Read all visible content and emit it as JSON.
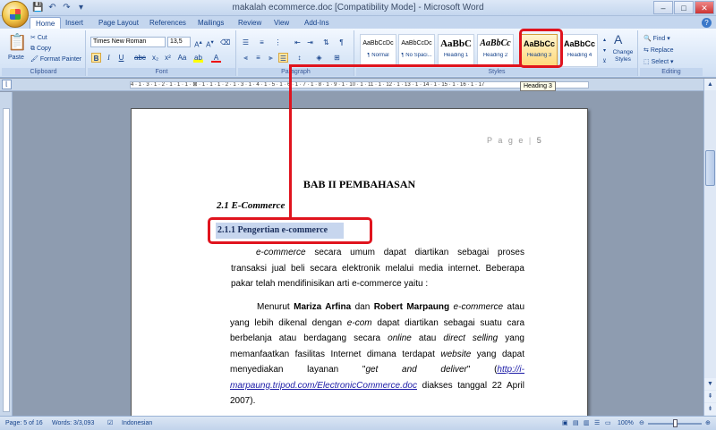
{
  "window": {
    "title": "makalah ecommerce.doc [Compatibility Mode] - Microsoft Word",
    "controls": [
      "–",
      "□",
      "✕"
    ]
  },
  "quick_access": [
    "💾",
    "↶",
    "↷",
    "▾"
  ],
  "tabs": [
    "Home",
    "Insert",
    "Page Layout",
    "References",
    "Mailings",
    "Review",
    "View",
    "Add-Ins"
  ],
  "ribbon": {
    "clipboard": {
      "paste_label": "Paste",
      "cut_label": "Cut",
      "copy_label": "Copy",
      "format_painter_label": "Format Painter",
      "group_label": "Clipboard"
    },
    "font": {
      "font_name": "Times New Roman",
      "font_size": "13,5",
      "group_label": "Font"
    },
    "paragraph": {
      "group_label": "Paragraph"
    },
    "styles": {
      "group_label": "Styles",
      "items": [
        {
          "sample": "AaBbCcDc",
          "name": "¶ Normal"
        },
        {
          "sample": "AaBbCcDc",
          "name": "¶ No Spaci..."
        },
        {
          "sample": "AaBbC",
          "name": "Heading 1"
        },
        {
          "sample": "AaBbCc",
          "name": "Heading 2"
        },
        {
          "sample": "AaBbCc",
          "name": "Heading 3"
        },
        {
          "sample": "AaBbCc",
          "name": "Heading 4"
        }
      ],
      "change_styles_label": "Change Styles"
    },
    "editing": {
      "group_label": "Editing",
      "find_label": "Find",
      "replace_label": "Replace",
      "select_label": "Select"
    }
  },
  "ruler": {
    "marks": "4 · 1 · 3 · 1 · 2 · 1 · 1 · 1 · ⊠ · 1 · 1 · 1 · 2 · 1 · 3 · 1 · 4 · 1 · 5 · 1 · 6 · 1 · 7 · 1 · 8 · 1 · 9 · 1 · 10 · 1 · 11 · 1 · 12 · 1 · 13 · 1 · 14 · 1 · 15 · 1 · 16 · 1 · 17"
  },
  "tooltip": "Heading 3",
  "document": {
    "header_text": "P a g e",
    "header_page": "5",
    "chapter_title": "BAB II PEMBAHASAN",
    "section_title": "2.1 E-Commerce",
    "subsection_title": "2.1.1 Pengertian e-commerce",
    "para1": {
      "term": "e-commerce",
      "text": " secara umum dapat diartikan sebagai proses transaksi jual beli secara elektronik melalui media internet. Beberapa pakar telah mendifinisikan arti e-commerce yaitu :"
    },
    "para2": {
      "t1": "Menurut ",
      "author1": "Mariza Arfina",
      "t2": " dan ",
      "author2": "Robert Marpaung",
      "t3": " ",
      "term1": "e-commerce",
      "t4": " atau yang lebih dikenal dengan ",
      "term2": "e-com",
      "t5": " dapat diartikan sebagai suatu cara berbelanja atau berdagang secara ",
      "term3": "online",
      "t6": " atau ",
      "term4": "direct selling",
      "t7": " yang memanfaatkan fasilitas Internet dimana terdapat ",
      "term5": "website",
      "t8": " yang dapat menyediakan layanan \"",
      "term6": "get and deliver",
      "t9": "\" (",
      "url": "http://i-marpaung.tripod.com/ElectronicCommerce.doc",
      "t10": " diakses tanggal 22 April 2007)."
    }
  },
  "status": {
    "page": "Page: 5 of 16",
    "words": "Words: 3/3,093",
    "language": "Indonesian",
    "zoom": "100%"
  },
  "colors": {
    "annotation": "#e0141e",
    "ribbon": "#dbe8f8",
    "heading3_highlight": "#c7d6ee"
  }
}
